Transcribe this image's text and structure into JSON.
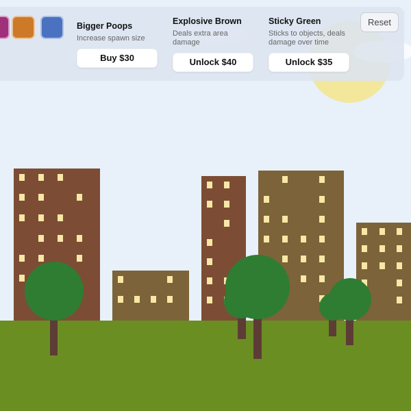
{
  "colors": {
    "sky": "#e8f0fa",
    "ground": "#6b8e23",
    "building_red_brown": "#7c4d34",
    "building_olive_brown": "#7c6339",
    "window": "#f8e7a6",
    "tree_foliage": "#2e7d32",
    "tree_trunk": "#5d3c36",
    "sun": "#f3e58a"
  },
  "palette": {
    "swatches": [
      {
        "name": "magenta-swatch",
        "color": "#a0307a"
      },
      {
        "name": "orange-swatch",
        "color": "#cc7a28"
      },
      {
        "name": "blue-swatch",
        "color": "#4a72c0"
      }
    ]
  },
  "upgrades": [
    {
      "title": "Bigger Poops",
      "description": "Increase spawn size",
      "button": "Buy $30"
    },
    {
      "title": "Explosive Brown",
      "description": "Deals extra area damage",
      "button": "Unlock $40"
    },
    {
      "title": "Sticky Green",
      "description": "Sticks to objects, deals damage over time",
      "button": "Unlock $35"
    }
  ],
  "reset": {
    "label": "Reset"
  }
}
